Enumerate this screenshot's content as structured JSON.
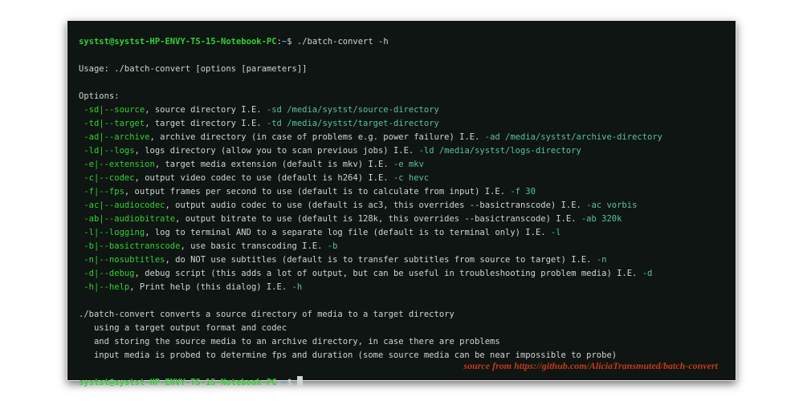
{
  "prompt": {
    "user": "systst",
    "at": "@",
    "host": "systst-HP-ENVY-TS-15-Notebook-PC",
    "colon": ":",
    "path": "~",
    "dollar": "$",
    "command": "./batch-convert -h"
  },
  "usage_line": "Usage: ./batch-convert [options [parameters]]",
  "options_header": "Options:",
  "options": [
    {
      "flag": "-sd|--source",
      "desc": ", source directory I.E. ",
      "example": "-sd /media/systst/source-directory"
    },
    {
      "flag": "-td|--target",
      "desc": ", target directory I.E. ",
      "example": "-td /media/systst/target-directory"
    },
    {
      "flag": "-ad|--archive",
      "desc": ", archive directory (in case of problems e.g. power failure) I.E. ",
      "example": "-ad /media/systst/archive-directory"
    },
    {
      "flag": "-ld|--logs",
      "desc": ", logs directory (allow you to scan previous jobs) I.E. ",
      "example": "-ld /media/systst/logs-directory"
    },
    {
      "flag": "-e|--extension",
      "desc": ", target media extension (default is mkv) I.E. ",
      "example": "-e mkv"
    },
    {
      "flag": "-c|--codec",
      "desc": ", output video codec to use (default is h264) I.E. ",
      "example": "-c hevc"
    },
    {
      "flag": "-f|--fps",
      "desc": ", output frames per second to use (default is to calculate from input) I.E. ",
      "example": "-f 30"
    },
    {
      "flag": "-ac|--audiocodec",
      "desc": ", output audio codec to use (default is ac3, this overrides --basictranscode) I.E. ",
      "example": "-ac vorbis"
    },
    {
      "flag": "-ab|--audiobitrate",
      "desc": ", output bitrate to use (default is 128k, this overrides --basictranscode) I.E. ",
      "example": "-ab 320k"
    },
    {
      "flag": "-l|--logging",
      "desc": ", log to terminal AND to a separate log file (default is to terminal only) I.E. ",
      "example": "-l"
    },
    {
      "flag": "-b|--basictranscode",
      "desc": ", use basic transcoding I.E. ",
      "example": "-b"
    },
    {
      "flag": "-n|--nosubtitles",
      "desc": ", do NOT use subtitles (default is to transfer subtitles from source to target) I.E. ",
      "example": "-n"
    },
    {
      "flag": "-d|--debug",
      "desc": ", debug script (this adds a lot of output, but can be useful in troubleshooting problem media) I.E. ",
      "example": "-d"
    },
    {
      "flag": "-h|--help",
      "desc": ", Print help (this dialog) I.E. ",
      "example": "-h"
    }
  ],
  "footer": [
    "./batch-convert converts a source directory of media to a target directory",
    "   using a target output format and codec",
    "   and storing the source media to an archive directory, in case there are problems",
    "   input media is probed to determine fps and duration (some source media can be near impossible to probe)"
  ],
  "attribution": "source from https://github.com/AliciaTransmuted/batch-convert"
}
